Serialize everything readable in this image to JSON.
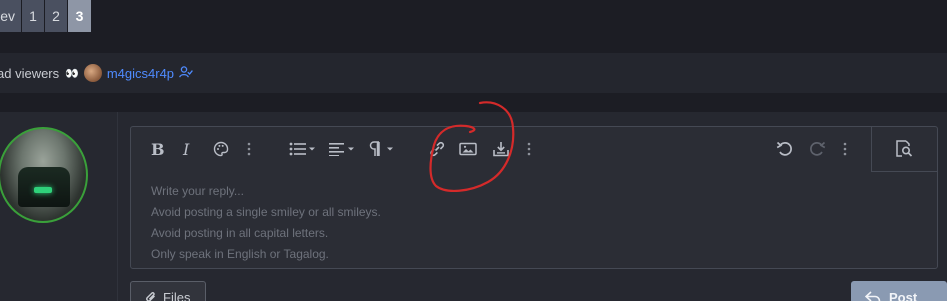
{
  "pagination": {
    "prev_label": "ev",
    "pages": [
      "1",
      "2"
    ],
    "current": "3"
  },
  "viewers": {
    "label": "ad viewers",
    "eyes": "👀",
    "username": "m4gics4r4p",
    "icon": "user-check-icon"
  },
  "toolbar": {
    "buttons": [
      {
        "name": "bold",
        "glyph": "B"
      },
      {
        "name": "italic",
        "glyph": "I"
      },
      {
        "name": "text-color",
        "icon": "palette-icon"
      },
      {
        "name": "more-text",
        "icon": "more-vertical-icon"
      },
      {
        "name": "list",
        "icon": "list-icon"
      },
      {
        "name": "align",
        "icon": "align-left-icon"
      },
      {
        "name": "paragraph",
        "icon": "pilcrow-icon"
      },
      {
        "name": "link",
        "icon": "link-icon"
      },
      {
        "name": "image",
        "icon": "image-icon"
      },
      {
        "name": "insert",
        "icon": "download-icon"
      },
      {
        "name": "more-insert",
        "icon": "more-vertical-icon"
      },
      {
        "name": "undo",
        "icon": "undo-icon"
      },
      {
        "name": "redo",
        "icon": "redo-icon"
      },
      {
        "name": "more-options",
        "icon": "more-vertical-icon"
      },
      {
        "name": "preview",
        "icon": "preview-search-icon"
      }
    ]
  },
  "editor": {
    "placeholder_lines": [
      "Write your reply...",
      "Avoid posting a single smiley or all smileys.",
      "Avoid posting in all capital letters.",
      "Only speak in English or Tagalog."
    ]
  },
  "actions": {
    "files_label": "Files",
    "post_label": "Post"
  },
  "colors": {
    "background": "#1c1d24",
    "accent_link": "#4f8bff",
    "annotation": "#d42a2a",
    "avatar_border": "#3aa03a"
  }
}
